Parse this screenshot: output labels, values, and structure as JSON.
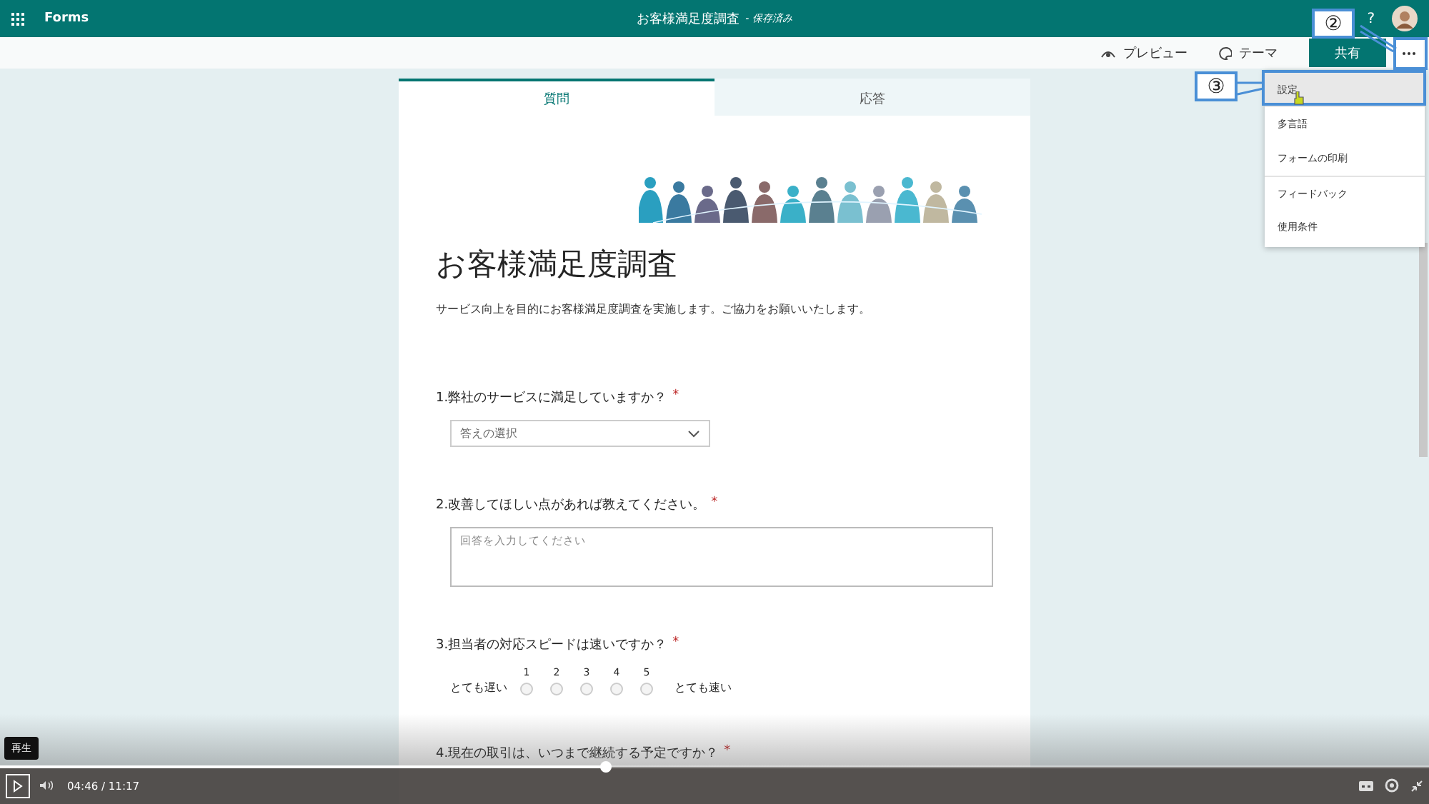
{
  "app_bar": {
    "app_name": "Forms",
    "title": "お客様満足度調査",
    "status": "- 保存済み",
    "help": "?"
  },
  "toolbar": {
    "preview": "プレビュー",
    "theme": "テーマ",
    "share": "共有"
  },
  "tabs": [
    {
      "label": "質問",
      "selected": true
    },
    {
      "label": "応答",
      "selected": false
    }
  ],
  "form": {
    "title": "お客様満足度調査",
    "description": "サービス向上を目的にお客様満足度調査を実施します。ご協力をお願いいたします。",
    "questions": [
      {
        "kind": "choice",
        "text": "1.弊社のサービスに満足していますか？",
        "mark": "*",
        "placeholder": "答えの選択"
      },
      {
        "kind": "text",
        "text": "2.改善してほしい点があれば教えてください。",
        "mark": "*",
        "placeholder": "回答を入力してください"
      },
      {
        "kind": "rating",
        "text": "3.担当者の対応スピードは速いですか？",
        "mark": "*",
        "scale": [
          {
            "label": "1",
            "selected": false
          },
          {
            "label": "2",
            "selected": false
          },
          {
            "label": "3",
            "selected": false
          },
          {
            "label": "4",
            "selected": false
          },
          {
            "label": "5",
            "selected": false
          }
        ],
        "low_label": "とても遅い",
        "high_label": "とても速い"
      },
      {
        "kind": "partial",
        "text": "4.現在の取引は、いつまで継続する予定ですか？",
        "mark": "*"
      }
    ]
  },
  "menu": [
    {
      "label": "設定",
      "selected": true,
      "separator_before": false
    },
    {
      "label": "多言語",
      "selected": false,
      "separator_before": false
    },
    {
      "label": "フォームの印刷",
      "selected": false,
      "separator_before": false
    },
    {
      "label": "フィードバック",
      "selected": false,
      "separator_before": true
    },
    {
      "label": "使用条件",
      "selected": false,
      "separator_before": false
    }
  ],
  "callouts": [
    {
      "label": "②"
    },
    {
      "label": "③"
    }
  ],
  "player": {
    "tooltip": "再生",
    "time": "04:46 / 11:17",
    "level": 0.424
  }
}
